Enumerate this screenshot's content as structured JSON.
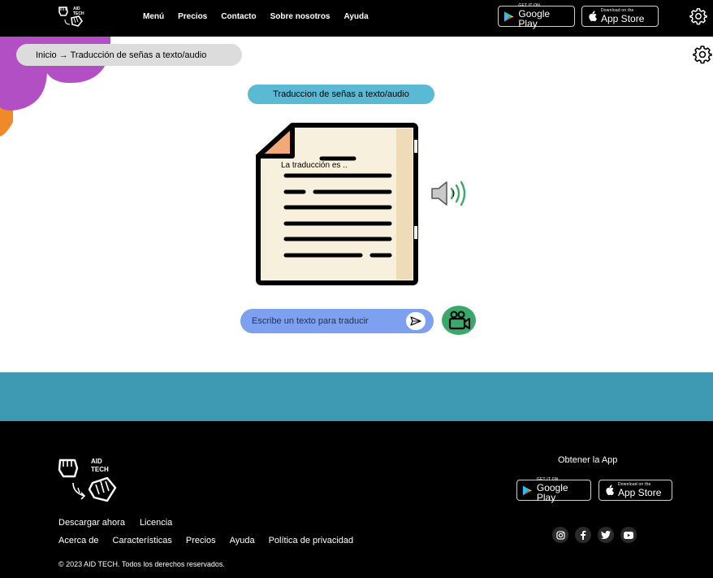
{
  "nav": {
    "links": [
      "Menú",
      "Precios",
      "Contacto",
      "Sobre nosotros",
      "Ayuda"
    ],
    "google_play": {
      "small": "GET IT ON",
      "big": "Google Play"
    },
    "app_store": {
      "small": "Download on the",
      "big": "App Store"
    }
  },
  "logo": {
    "line1": "AID",
    "line2": "TECH"
  },
  "breadcrumb": {
    "text": "Inicio → Traducción de señas a texto/audio"
  },
  "main": {
    "title": "Traduccion de señas a texto/audio",
    "document_text": "La traducción es ..",
    "input_placeholder": "Escribe un texto para traducir"
  },
  "footer": {
    "links_row1": [
      "Descargar ahora",
      "Licencia"
    ],
    "links_row2": [
      "Acerca de",
      "Características",
      "Precios",
      "Ayuda",
      "Política de privacidad"
    ],
    "copyright": "© 2023 AID TECH. Todos los derechos reservados.",
    "get_app": "Obtener la App",
    "google_play": {
      "small": "GET IT ON",
      "big": "Google Play"
    },
    "app_store": {
      "small": "Download on the",
      "big": "App Store"
    },
    "socials": [
      "instagram-icon",
      "facebook-icon",
      "twitter-icon",
      "youtube-icon"
    ]
  },
  "colors": {
    "nav_bg": "#000000",
    "pill": "#5bbad3",
    "input": "#7ea0f0",
    "band": "#3e9ab3",
    "camera": "#3aa86b",
    "blob_purple": "#b24fc4",
    "blob_orange": "#f08a28"
  }
}
